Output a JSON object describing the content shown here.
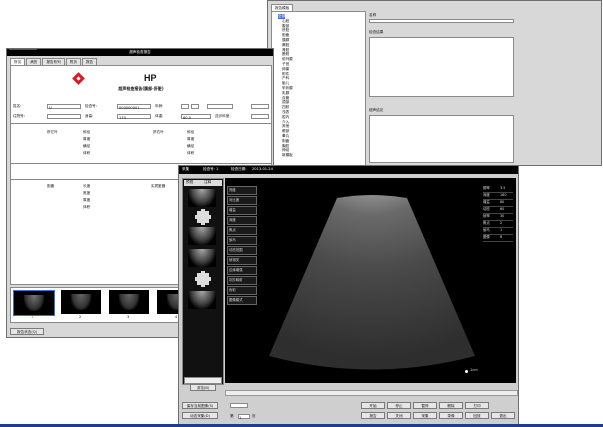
{
  "report_window": {
    "title": "超声检查报告",
    "tabs": [
      "所见",
      "病历",
      "报告系列",
      "附页",
      "报告"
    ],
    "logo_text": "HP",
    "report_heading": "超声检查报告(腹部-肝脏)",
    "fields": {
      "name_label": "姓名:",
      "exam_no_label": "检查号:",
      "exam_no_value": "000000001",
      "age_label": "年龄:",
      "inpatient_label": "住院号:",
      "height_label": "身高:",
      "height_value": "170",
      "weight_label": "体重:",
      "weight_value": "60.0",
      "dept_label": "送诊科室:"
    },
    "liver_left": {
      "title": "肝左叶",
      "items": [
        "斜径",
        "厚度",
        "横径",
        "体积"
      ]
    },
    "liver_right": {
      "title": "肝右叶",
      "items": [
        "斜径",
        "厚度",
        "横径",
        "体积"
      ]
    },
    "gallbladder": {
      "title": "胆囊",
      "items": [
        "长度",
        "宽度",
        "厚度",
        "体积"
      ]
    },
    "spleen": {
      "title": "实质脏器"
    },
    "thumb_labels": [
      "1",
      "2",
      "3",
      "4"
    ],
    "footer_button": "报告状态(Q)"
  },
  "template_window": {
    "tab": "报告模板",
    "tree": [
      "全部",
      "心脏",
      "腹部",
      "肝脏",
      "胆囊",
      "胰腺",
      "脾脏",
      "肾脏",
      "膀胱",
      "前列腺",
      "子宫",
      "卵巢",
      "附件",
      "产科",
      "胎儿",
      "甲状腺",
      "乳腺",
      "血管",
      "颈部",
      "四肢",
      "浅表",
      "腔内",
      "介入",
      "其他",
      "眼部",
      "睾丸",
      "阴囊",
      "胸腔",
      "神经",
      "新模板"
    ],
    "name_label": "名称",
    "findings_label": "检查结果",
    "conclusion_label": "超声结论"
  },
  "capture_window": {
    "title": "采集",
    "exam_no": "检查号: 1",
    "exam_date_label": "检查日期:",
    "exam_date": "2013-01-24",
    "left_tabs": [
      "预视",
      "注释"
    ],
    "controls": [
      "亮度",
      "对比度",
      "增益",
      "深度",
      "焦点",
      "伽马",
      "动态范围",
      "帧相关",
      "边缘增强",
      "灰阶映射",
      "伪彩",
      "图像模式"
    ],
    "right_info": [
      [
        "频率",
        "3.5"
      ],
      [
        "深度",
        "160"
      ],
      [
        "增益",
        "80"
      ],
      [
        "动态",
        "60"
      ],
      [
        "帧率",
        "30"
      ],
      [
        "焦点",
        "2"
      ],
      [
        "伽马",
        "1"
      ],
      [
        "图像",
        "B"
      ]
    ],
    "buttons_bottom": [
      "保存当前图像(S)",
      "动态采集(D)",
      "开始",
      "停止",
      "暂停",
      "删除",
      "打印",
      "报告",
      "关闭",
      "采集",
      "录像",
      "回放",
      "退出"
    ],
    "page_label": "第",
    "page_value": "1",
    "page_total": "页",
    "scale_label": "1cm",
    "view_button": "浏览(B)"
  }
}
